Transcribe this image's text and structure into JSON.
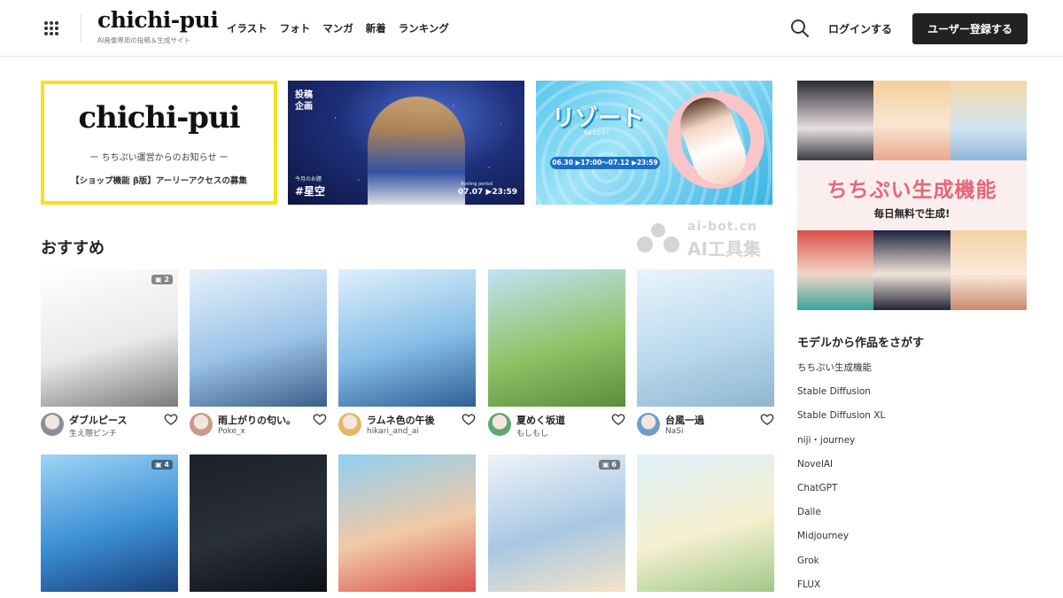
{
  "header": {
    "logo": "chichi-pui",
    "tagline": "AI画像専用の投稿＆生成サイト",
    "nav": [
      "イラスト",
      "フォト",
      "マンガ",
      "新着",
      "ランキング"
    ],
    "login_label": "ログインする",
    "register_label": "ユーザー登録する"
  },
  "banners": [
    {
      "logo": "chichi-pui",
      "subtitle": "ー ちちぷい運営からのお知らせ ー",
      "description": "【ショップ機能 β版】アーリーアクセスの募集"
    },
    {
      "badge": "投稿企画",
      "tag_small": "今月のお題",
      "tag": "#星空",
      "date_small": "Posting period",
      "date": "07.07 ▶23:59"
    },
    {
      "title": "リゾート",
      "subtitle": "RESORT",
      "date": "06.30 ▶17:00～07.12 ▶23:59"
    }
  ],
  "side_banner": {
    "title": "ちちぷい生成機能",
    "subtitle": "毎日無料で生成!"
  },
  "watermark": {
    "url": "ai-bot.cn",
    "name": "AI工具集"
  },
  "section_title": "おすすめ",
  "cards": [
    {
      "title": "ダブルピース",
      "user": "生え際ピンチ",
      "count": "2",
      "colors": [
        "#ffffff",
        "#e9e9e9",
        "#7b7b7b"
      ],
      "avatar": "#8a9099"
    },
    {
      "title": "雨上がりの匂い。",
      "user": "Poke_x",
      "count": "",
      "colors": [
        "#e6f1fb",
        "#9cc3e8",
        "#3b5f8c"
      ],
      "avatar": "#c79a8a"
    },
    {
      "title": "ラムネ色の午後",
      "user": "hikari_and_ai",
      "count": "",
      "colors": [
        "#dff0fb",
        "#86bde7",
        "#2f5f95"
      ],
      "avatar": "#e2b765"
    },
    {
      "title": "夏めく坂道",
      "user": "もしもし",
      "count": "",
      "colors": [
        "#bfe3f7",
        "#8fc46a",
        "#5a8e3a"
      ],
      "avatar": "#5fa870"
    },
    {
      "title": "台風一過",
      "user": "NaSi",
      "count": "",
      "colors": [
        "#eaf4fb",
        "#b9d9ee",
        "#8fb6cf"
      ],
      "avatar": "#6f9ccc"
    },
    {
      "title": "",
      "user": "",
      "count": "4",
      "colors": [
        "#9fd4f5",
        "#3c8fd6",
        "#1a3f7a"
      ],
      "avatar": "#6f9ccc"
    },
    {
      "title": "",
      "user": "",
      "count": "",
      "colors": [
        "#1c2128",
        "#2a3038",
        "#0d1014"
      ],
      "avatar": "#333333"
    },
    {
      "title": "",
      "user": "",
      "count": "",
      "colors": [
        "#8fd0f2",
        "#f1c9a6",
        "#d9534f"
      ],
      "avatar": "#d39b7a"
    },
    {
      "title": "",
      "user": "",
      "count": "6",
      "colors": [
        "#eef3f8",
        "#a9c8e4",
        "#f4e3c8"
      ],
      "avatar": "#a9c8e4"
    },
    {
      "title": "",
      "user": "",
      "count": "",
      "colors": [
        "#dff1fb",
        "#f6f0d0",
        "#9fc98a"
      ],
      "avatar": "#9fc98a"
    }
  ],
  "models": {
    "title": "モデルから作品をさがす",
    "items": [
      "ちちぷい生成機能",
      "Stable Diffusion",
      "Stable Diffusion XL",
      "niji・journey",
      "NovelAI",
      "ChatGPT",
      "Dalle",
      "Midjourney",
      "Grok",
      "FLUX"
    ]
  }
}
